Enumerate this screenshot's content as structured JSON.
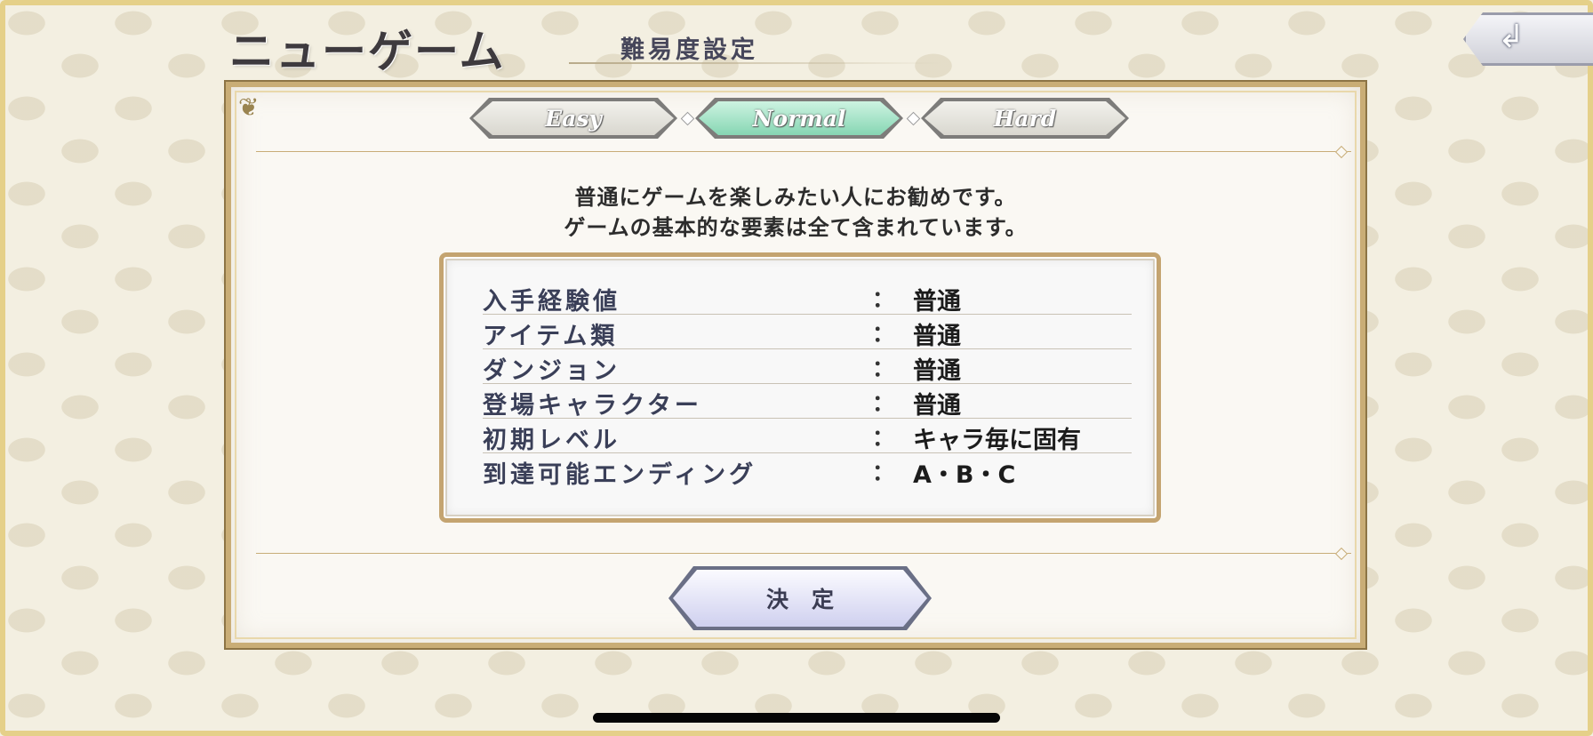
{
  "header": {
    "title": "ニューゲーム",
    "subtitle": "難易度設定",
    "back_icon": "↲"
  },
  "difficulty_tabs": [
    {
      "label": "Easy",
      "selected": false
    },
    {
      "label": "Normal",
      "selected": true
    },
    {
      "label": "Hard",
      "selected": false
    }
  ],
  "description": {
    "line1": "普通にゲームを楽しみたい人にお勧めです。",
    "line2": "ゲームの基本的な要素は全て含まれています。"
  },
  "stats": [
    {
      "label": "入手経験値",
      "colon": "：",
      "value": "普通"
    },
    {
      "label": "アイテム類",
      "colon": "：",
      "value": "普通"
    },
    {
      "label": "ダンジョン",
      "colon": "：",
      "value": "普通"
    },
    {
      "label": "登場キャラクター",
      "colon": "：",
      "value": "普通"
    },
    {
      "label": "初期レベル",
      "colon": "：",
      "value": "キャラ毎に固有"
    },
    {
      "label": "到達可能エンディング",
      "colon": "：",
      "value": "A・B・C"
    }
  ],
  "confirm_label": "決定",
  "colors": {
    "selected_tab": "#86d6b3",
    "frame_gold": "#c9ad76",
    "confirm_button": "#cfd0ef"
  },
  "icons": {
    "back": "return-arrow-icon",
    "corner": "floral-ornament-icon"
  }
}
